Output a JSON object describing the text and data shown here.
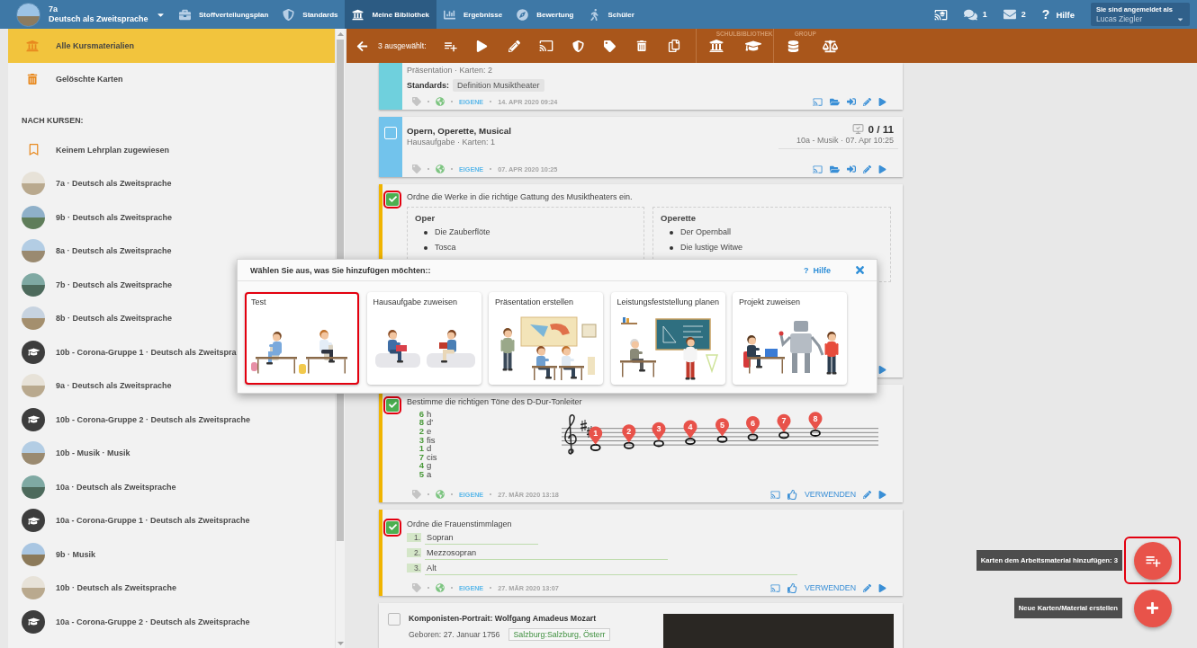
{
  "topbar": {
    "course": {
      "class": "7a",
      "name": "Deutsch als Zweitsprache"
    },
    "nav": [
      {
        "label": "Stoffverteilungsplan",
        "selected": false
      },
      {
        "label": "Standards",
        "selected": false
      },
      {
        "label": "Meine Bibliothek",
        "selected": true
      },
      {
        "label": "Ergebnisse",
        "selected": false
      },
      {
        "label": "Bewertung",
        "selected": false
      },
      {
        "label": "Schüler",
        "selected": false
      }
    ],
    "messages": "1",
    "mail": "2",
    "help": {
      "symbol": "?",
      "label": "Hilfe"
    },
    "user": {
      "caption": "Sie sind angemeldet als",
      "name": "Lucas Ziegler"
    }
  },
  "sidebar": {
    "sections": [
      {
        "label": "Alle Kursmaterialien",
        "selected": true
      },
      {
        "label": "Gelöschte Karten",
        "selected": false
      }
    ],
    "courses_heading": "NACH KURSEN:",
    "courses": [
      {
        "kind": "unassigned",
        "label": "Keinem Lehrplan zugewiesen"
      },
      {
        "kind": "photo",
        "label": "7a · Deutsch als Zweitsprache"
      },
      {
        "kind": "photo",
        "label": "9b · Deutsch als Zweitsprache"
      },
      {
        "kind": "photo",
        "label": "8a · Deutsch als Zweitsprache"
      },
      {
        "kind": "photo",
        "label": "7b · Deutsch als Zweitsprache"
      },
      {
        "kind": "photo",
        "label": "8b · Deutsch als Zweitsprache"
      },
      {
        "kind": "group",
        "label": "10b - Corona-Gruppe 1 · Deutsch als Zweitspra"
      },
      {
        "kind": "photo",
        "label": "9a · Deutsch als Zweitsprache"
      },
      {
        "kind": "group",
        "label": "10b - Corona-Gruppe 2 · Deutsch als Zweitsprache"
      },
      {
        "kind": "photo",
        "label": "10b - Musik · Musik"
      },
      {
        "kind": "photo",
        "label": "10a · Deutsch als Zweitsprache"
      },
      {
        "kind": "group",
        "label": "10a - Corona-Gruppe 1 · Deutsch als Zweitsprache"
      },
      {
        "kind": "photo",
        "label": "9b · Musik"
      },
      {
        "kind": "photo",
        "label": "10b · Deutsch als Zweitsprache"
      },
      {
        "kind": "group",
        "label": "10a - Corona-Gruppe 2 · Deutsch als Zweitsprache"
      }
    ]
  },
  "toolbar": {
    "selection": "3 ausgewählt:",
    "groups": [
      {
        "label": "SCHULBIBLIOTHEK"
      },
      {
        "label": "GROUP"
      }
    ]
  },
  "cards": [
    {
      "kind": "material",
      "color": "#6fd0dd",
      "subtitle": "Präsentation · Karten: 2",
      "standards_label": "Standards:",
      "standards": [
        "Definition Musiktheater"
      ],
      "footer": {
        "owner": "EIGENE",
        "date": "14. APR 2020 09:24"
      }
    },
    {
      "kind": "material",
      "color": "#72c3ec",
      "checked": false,
      "title": "Opern, Operette, Musical",
      "subtitle": "Hausaufgabe · Karten: 1",
      "progress": "0 / 11",
      "assignment": "10a - Musik · 07. Apr 10:25",
      "footer": {
        "owner": "EIGENE",
        "date": "07. APR 2020 10:25"
      }
    },
    {
      "kind": "categorize",
      "color": "#f0b400",
      "checked": true,
      "highlighted": true,
      "question": "Ordne die Werke in die richtige Gattung des Musiktheaters ein.",
      "groups": [
        {
          "title": "Oper",
          "items": [
            "Die Zauberflöte",
            "Tosca"
          ]
        },
        {
          "title": "Operette",
          "items": [
            "Der Opernball",
            "Die lustige Witwe"
          ]
        }
      ]
    },
    {
      "kind": "scale",
      "color": "#f0b400",
      "checked": true,
      "highlighted": true,
      "question": "Bestimme die richtigen Töne des D-Dur-Tonleiter",
      "pairs": [
        {
          "number": "6",
          "note": "h"
        },
        {
          "number": "8",
          "note": "d'"
        },
        {
          "number": "2",
          "note": "e"
        },
        {
          "number": "3",
          "note": "fis"
        },
        {
          "number": "1",
          "note": "d"
        },
        {
          "number": "7",
          "note": "cis"
        },
        {
          "number": "4",
          "note": "g"
        },
        {
          "number": "5",
          "note": "a"
        }
      ],
      "markers": [
        "1",
        "2",
        "3",
        "4",
        "5",
        "6",
        "7",
        "8"
      ],
      "footer": {
        "owner": "EIGENE",
        "date": "27. MÄR 2020 13:18",
        "use": "VERWENDEN"
      }
    },
    {
      "kind": "order",
      "color": "#f0b400",
      "checked": true,
      "highlighted": true,
      "question": "Ordne die Frauenstimmlagen",
      "items": [
        {
          "number": "1.",
          "text": "Sopran"
        },
        {
          "number": "2.",
          "text": "Mezzosopran"
        },
        {
          "number": "3.",
          "text": "Alt"
        }
      ],
      "footer": {
        "owner": "EIGENE",
        "date": "27. MÄR 2020 13:07",
        "use": "VERWENDEN"
      }
    },
    {
      "kind": "portrait",
      "checked": false,
      "title": "Komponisten-Portrait: Wolfgang Amadeus Mozart",
      "born": "Geboren: 27. Januar 1756",
      "place": "Salzburg:Salzburg, Österr"
    }
  ],
  "dialog": {
    "title": "Wählen Sie aus, was Sie hinzufügen möchten::",
    "help": {
      "symbol": "?",
      "label": "Hilfe"
    },
    "options": [
      {
        "label": "Test",
        "selected": true
      },
      {
        "label": "Hausaufgabe zuweisen",
        "selected": false
      },
      {
        "label": "Präsentation erstellen",
        "selected": false
      },
      {
        "label": "Leistungsfeststellung planen",
        "selected": false
      },
      {
        "label": "Projekt zuweisen",
        "selected": false
      }
    ]
  },
  "actions": [
    {
      "kind": "add",
      "tooltip": "Karten dem Arbeitsmaterial hinzufügen: 3",
      "highlighted": true
    },
    {
      "kind": "create",
      "tooltip": "Neue Karten/Material erstellen",
      "highlighted": false
    }
  ]
}
